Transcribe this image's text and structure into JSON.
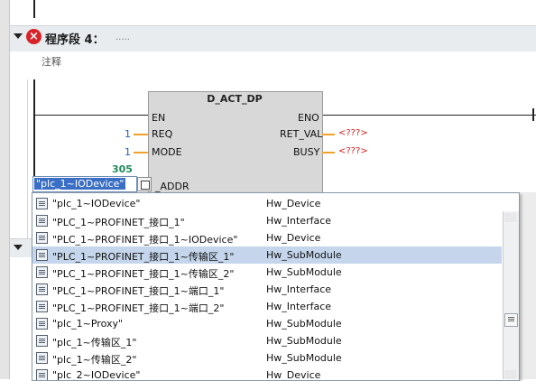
{
  "network": {
    "title": "程序段 4：",
    "dots": ".....",
    "comment_label": "注释",
    "error": true
  },
  "block": {
    "title": "D_ACT_DP",
    "inputs": [
      {
        "pin": "EN",
        "value": ""
      },
      {
        "pin": "REQ",
        "value": "1"
      },
      {
        "pin": "MODE",
        "value": "1"
      },
      {
        "pin": "_ADDR",
        "value": "305"
      }
    ],
    "outputs": [
      {
        "pin": "ENO",
        "value": ""
      },
      {
        "pin": "RET_VAL",
        "value": "<???>"
      },
      {
        "pin": "BUSY",
        "value": "<???>"
      }
    ]
  },
  "editor": {
    "input_value": "\"plc_1~IODevice\""
  },
  "dropdown": {
    "items": [
      {
        "name": "\"plc_1~IODevice\"",
        "type": "Hw_Device"
      },
      {
        "name": "\"PLC_1~PROFINET_接口_1\"",
        "type": "Hw_Interface"
      },
      {
        "name": "\"PLC_1~PROFINET_接口_1~IODevice\"",
        "type": "Hw_Device"
      },
      {
        "name": "\"PLC_1~PROFINET_接口_1~传输区_1\"",
        "type": "Hw_SubModule"
      },
      {
        "name": "\"PLC_1~PROFINET_接口_1~传输区_2\"",
        "type": "Hw_SubModule"
      },
      {
        "name": "\"PLC_1~PROFINET_接口_1~端口_1\"",
        "type": "Hw_Interface"
      },
      {
        "name": "\"PLC_1~PROFINET_接口_1~端口_2\"",
        "type": "Hw_Interface"
      },
      {
        "name": "\"plc_1~Proxy\"",
        "type": "Hw_SubModule"
      },
      {
        "name": "\"plc_1~传输区_1\"",
        "type": "Hw_SubModule"
      },
      {
        "name": "\"plc_1~传输区_2\"",
        "type": "Hw_SubModule"
      },
      {
        "name": "\"plc_2~IODevice\"",
        "type": "Hw_Device"
      }
    ]
  },
  "colors": {
    "accent_selection": "#3b6fc5",
    "error_red": "#d8232a",
    "pin_orange": "#f3a12b",
    "value_green": "#1f8a5a"
  }
}
